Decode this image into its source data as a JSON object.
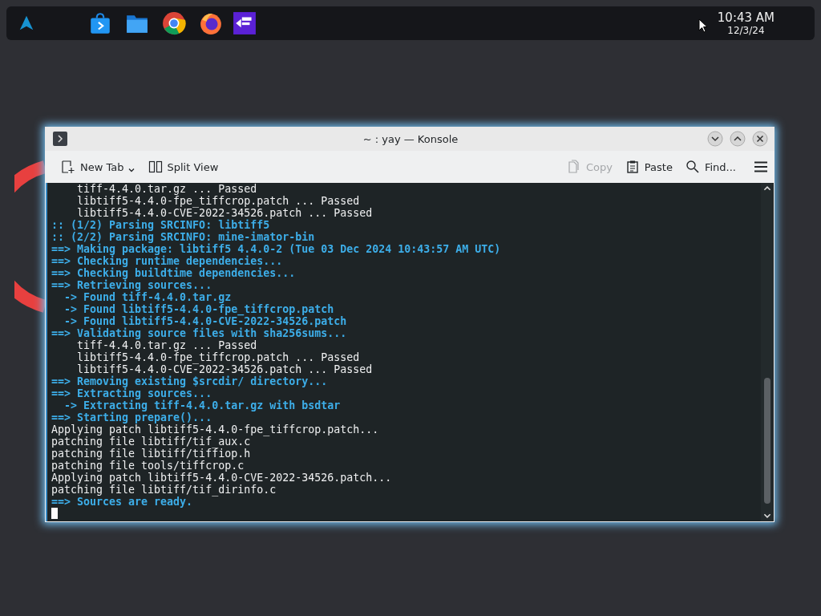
{
  "taskbar": {
    "clock": {
      "time": "10:43 AM",
      "date": "12/3/24"
    }
  },
  "window": {
    "title": "~ : yay — Konsole"
  },
  "toolbar": {
    "left": [
      {
        "label": "New Tab",
        "kind": "newtab",
        "disabled": false
      },
      {
        "label": "Split View",
        "kind": "split",
        "disabled": false
      }
    ],
    "right": [
      {
        "label": "Copy",
        "kind": "copy",
        "disabled": true
      },
      {
        "label": "Paste",
        "kind": "paste",
        "disabled": false
      },
      {
        "label": "Find...",
        "kind": "find",
        "disabled": false
      }
    ]
  },
  "terminal": {
    "lines": [
      {
        "kind": "plain",
        "text": "    tiff-4.4.0.tar.gz ... Passed"
      },
      {
        "kind": "plain",
        "text": "    libtiff5-4.4.0-fpe_tiffcrop.patch ... Passed"
      },
      {
        "kind": "plain",
        "text": "    libtiff5-4.4.0-CVE-2022-34526.patch ... Passed"
      },
      {
        "kind": "info",
        "text": ":: (1/2) Parsing SRCINFO: libtiff5"
      },
      {
        "kind": "info",
        "text": ":: (2/2) Parsing SRCINFO: mine-imator-bin"
      },
      {
        "kind": "info",
        "text": "==> Making package: libtiff5 4.4.0-2 (Tue 03 Dec 2024 10:43:57 AM UTC)"
      },
      {
        "kind": "info",
        "text": "==> Checking runtime dependencies..."
      },
      {
        "kind": "info",
        "text": "==> Checking buildtime dependencies..."
      },
      {
        "kind": "info",
        "text": "==> Retrieving sources..."
      },
      {
        "kind": "info",
        "text": "  -> Found tiff-4.4.0.tar.gz"
      },
      {
        "kind": "info",
        "text": "  -> Found libtiff5-4.4.0-fpe_tiffcrop.patch"
      },
      {
        "kind": "info",
        "text": "  -> Found libtiff5-4.4.0-CVE-2022-34526.patch"
      },
      {
        "kind": "info",
        "text": "==> Validating source files with sha256sums..."
      },
      {
        "kind": "plain",
        "text": "    tiff-4.4.0.tar.gz ... Passed"
      },
      {
        "kind": "plain",
        "text": "    libtiff5-4.4.0-fpe_tiffcrop.patch ... Passed"
      },
      {
        "kind": "plain",
        "text": "    libtiff5-4.4.0-CVE-2022-34526.patch ... Passed"
      },
      {
        "kind": "info",
        "text": "==> Removing existing $srcdir/ directory..."
      },
      {
        "kind": "info",
        "text": "==> Extracting sources..."
      },
      {
        "kind": "info",
        "text": "  -> Extracting tiff-4.4.0.tar.gz with bsdtar"
      },
      {
        "kind": "info",
        "text": "==> Starting prepare()..."
      },
      {
        "kind": "plain",
        "text": "Applying patch libtiff5-4.4.0-fpe_tiffcrop.patch..."
      },
      {
        "kind": "plain",
        "text": "patching file libtiff/tif_aux.c"
      },
      {
        "kind": "plain",
        "text": "patching file libtiff/tiffiop.h"
      },
      {
        "kind": "plain",
        "text": "patching file tools/tiffcrop.c"
      },
      {
        "kind": "plain",
        "text": "Applying patch libtiff5-4.4.0-CVE-2022-34526.patch..."
      },
      {
        "kind": "plain",
        "text": "patching file libtiff/tif_dirinfo.c"
      },
      {
        "kind": "info",
        "text": "==> Sources are ready."
      }
    ]
  }
}
